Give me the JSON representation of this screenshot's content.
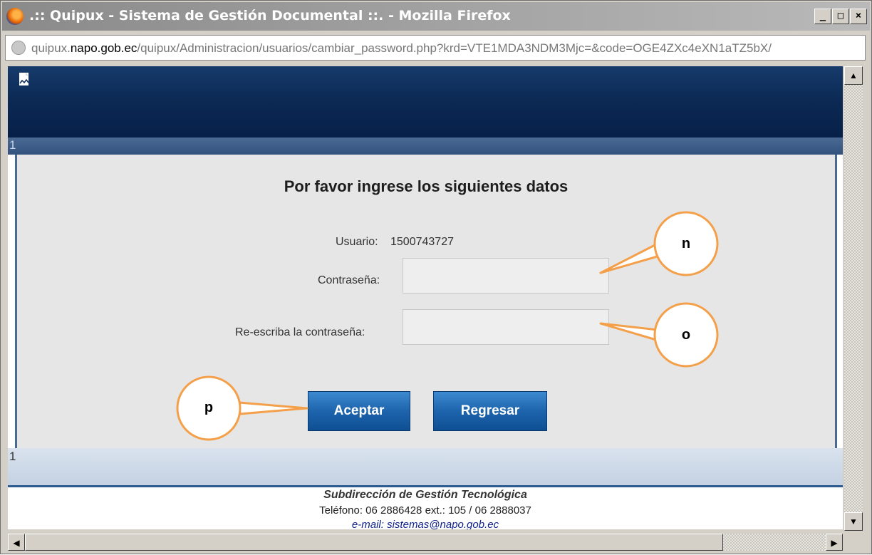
{
  "window": {
    "title": ".:: Quipux - Sistema de Gestión Documental ::. - Mozilla Firefox",
    "controls": {
      "minimize": "_",
      "maximize": "□",
      "close": "×"
    }
  },
  "address_bar": {
    "url_prefix": "quipux.",
    "url_domain": "napo.gob.ec",
    "url_rest": "/quipux/Administracion/usuarios/cambiar_password.php?krd=VTE1MDA3NDM3Mjc=&code=OGE4ZXc4eXN1aTZ5bX/"
  },
  "page": {
    "strip_top_label": "1",
    "strip_bottom_label": "1",
    "form": {
      "title": "Por favor ingrese los siguientes datos",
      "usuario_label": "Usuario:",
      "usuario_value": "1500743727",
      "password_label": "Contraseña:",
      "password_value": "",
      "repassword_label": "Re-escriba la contraseña:",
      "repassword_value": ""
    },
    "buttons": {
      "accept": "Aceptar",
      "back": "Regresar"
    },
    "footer": {
      "line1": "Subdirección de Gestión Tecnológica",
      "line2": "Teléfono: 06 2886428 ext.: 105 /  06 2888037",
      "line3": "e-mail: sistemas@napo.gob.ec"
    }
  },
  "callouts": {
    "n": "n",
    "o": "o",
    "p": "p"
  },
  "icons": {
    "window_icon": "firefox-logo-icon",
    "site_icon": "globe-icon",
    "page_icon": "document-icon"
  },
  "colors": {
    "header_blue": "#0c2a55",
    "button_blue": "#1d64ad",
    "callout_fill": "#ffffff",
    "callout_stroke": "#f4a04a",
    "footer_email": "#0d1f8a"
  }
}
